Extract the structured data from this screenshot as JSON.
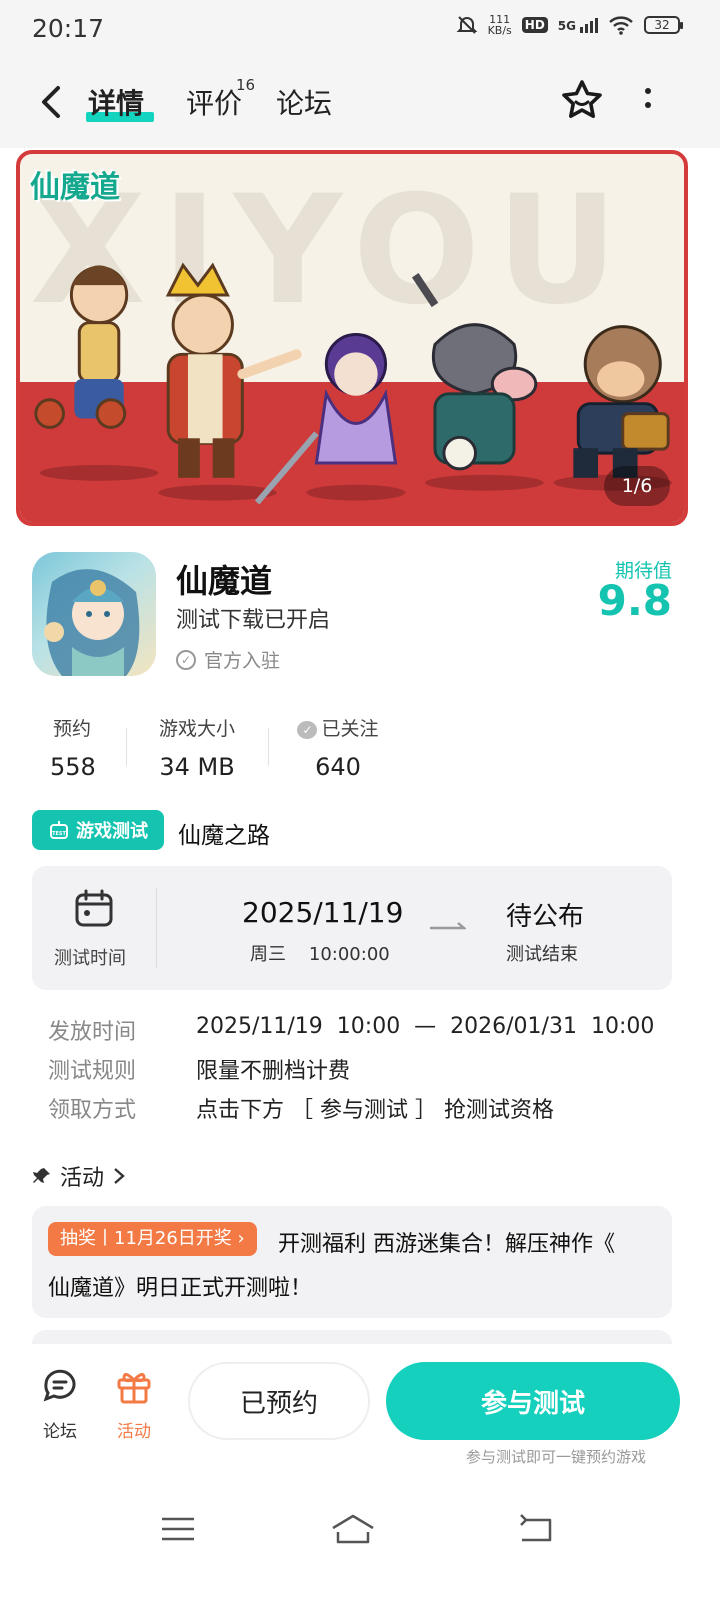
{
  "status_bar": {
    "time": "20:17",
    "speed_value": "111",
    "speed_unit": "KB/s",
    "hd": "HD",
    "network": "5G",
    "battery": "32"
  },
  "header": {
    "tabs": [
      {
        "label": "详情",
        "active": true
      },
      {
        "label": "评价",
        "badge": "16"
      },
      {
        "label": "论坛"
      }
    ]
  },
  "banner": {
    "logo_text": "仙魔道",
    "bg_text": "XIYOU",
    "counter": "1/6"
  },
  "app": {
    "title": "仙魔道",
    "subtitle": "测试下载已开启",
    "official": "官方入驻",
    "expect_label": "期待值",
    "expect_value": "9.8"
  },
  "stats": [
    {
      "label": "预约",
      "value": "558"
    },
    {
      "label": "游戏大小",
      "value": "34  MB"
    },
    {
      "label": "已关注",
      "value": "640"
    }
  ],
  "test": {
    "tag_label": "游戏测试",
    "tag_icon_text": "TEST",
    "name": "仙魔之路",
    "time_label": "测试时间",
    "start_date": "2025/11/19",
    "start_detail": "周三    10:00:00",
    "end_title": "待公布",
    "end_label": "测试结束"
  },
  "details": [
    {
      "key": "发放时间",
      "value": "2025/11/19  10:00  —  2026/01/31  10:00"
    },
    {
      "key": "测试规则",
      "value": "限量不删档计费"
    },
    {
      "key": "领取方式",
      "value": "点击下方 ［ 参与测试 ］ 抢测试资格"
    }
  ],
  "activity": {
    "header": "活动",
    "tag": "抽奖丨11月26日开奖",
    "text_line1": "开测福利  西游迷集合！解压神作《",
    "text_line2": "仙魔道》明日正式开测啦！"
  },
  "bottom_bar": {
    "forum_label": "论坛",
    "activity_label": "活动",
    "reserved_label": "已预约",
    "join_label": "参与测试",
    "join_hint": "参与测试即可一键预约游戏"
  },
  "colors": {
    "accent": "#14d0bc",
    "orange": "#f47a45",
    "banner_red": "#cf3b3b"
  }
}
